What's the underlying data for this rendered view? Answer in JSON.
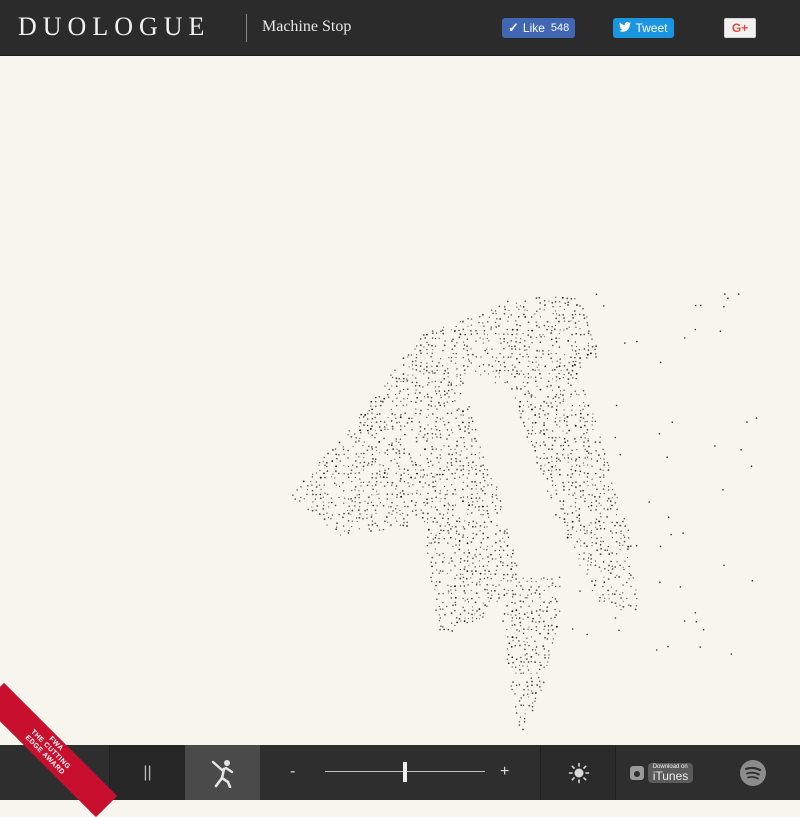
{
  "header": {
    "brand": "DUOLOGUE",
    "subtitle": "Machine Stop",
    "like_label": "Like",
    "like_count": "548",
    "tweet_label": "Tweet",
    "gplus_label": "G+"
  },
  "footer": {
    "pause_label": "||",
    "slider_minus": "-",
    "slider_plus": "+",
    "slider_level": 0.5,
    "itunes_small": "Download on",
    "itunes_label": "iTunes"
  },
  "ribbon": {
    "brand": "FWA",
    "line1": "THE CUTTING",
    "line2": "EDGE AWARD"
  },
  "colors": {
    "header_bg": "#2b2b2b",
    "canvas_bg": "#f8f5ef",
    "like_blue": "#4267b2",
    "tweet_blue": "#1b95e0",
    "gplus_red": "#dd4b39",
    "ribbon_red": "#c8102e"
  },
  "icons": [
    "checkmark-icon",
    "twitter-bird-icon",
    "pause-icon",
    "dancer-icon",
    "sun-icon",
    "itunes-icon",
    "spotify-icon"
  ]
}
